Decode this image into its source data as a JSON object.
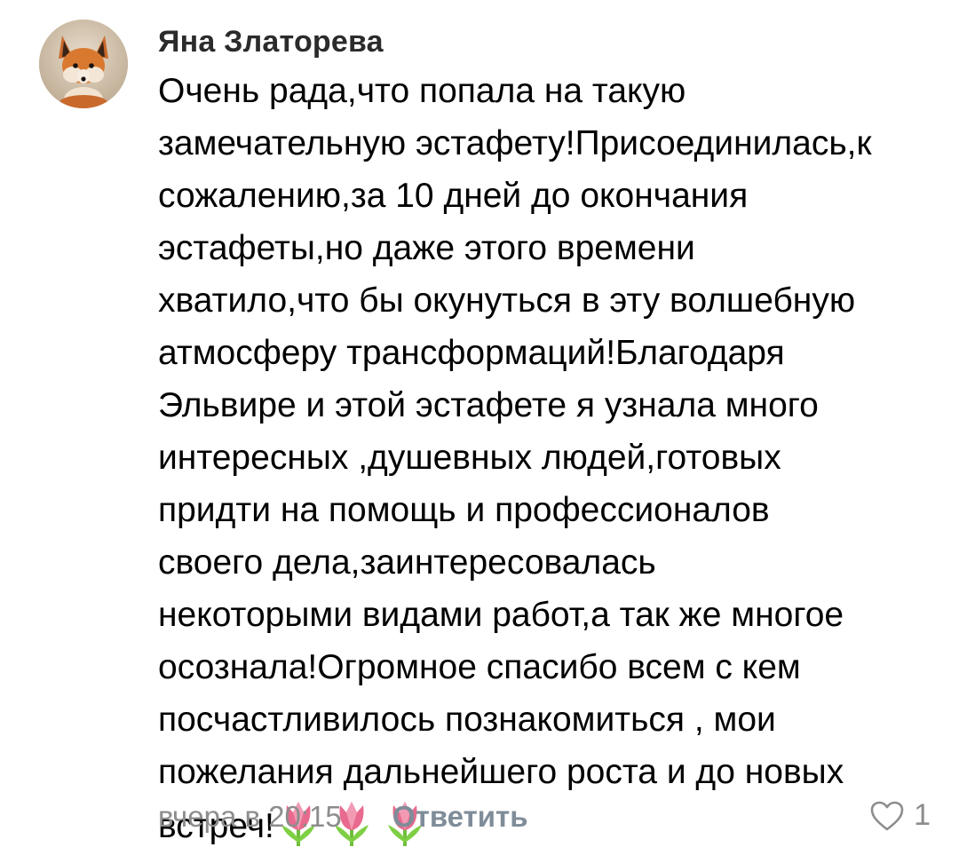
{
  "comment": {
    "author": "Яна Златорева",
    "avatar_icon": "fox-avatar",
    "lines": [
      "Очень рада,что попала на такую",
      "замечательную эстафету!Присоединилась,к",
      "сожалению,за 10 дней до окончания",
      "эстафеты,но даже этого времени",
      "хватило,что бы окунуться в эту волшебную",
      "атмосферу трансформаций!Благодаря",
      "Эльвире и этой эстафете я узнала много",
      "интересных ,душевных людей,готовых",
      "придти на помощь и профессионалов",
      "своего дела,заинтересовалась",
      "некоторыми видами работ,а так же многое",
      "осознала!Огромное спасибо всем с кем",
      "посчастливилось познакомиться , мои",
      "пожелания дальнейшего роста  и до новых",
      "встреч!"
    ],
    "emoji": [
      "🌷",
      "🌷",
      "🌷"
    ],
    "timestamp": "вчера в 20:15",
    "reply_label": "Ответить",
    "like_icon": "heart-outline-icon",
    "like_count": "1"
  },
  "colors": {
    "text": "#000000",
    "author": "#2b2b2b",
    "meta": "#8d8d8d",
    "reply": "#7f8c99",
    "tulip_petal": "#e86a8e",
    "tulip_stem": "#6fbf3c"
  }
}
